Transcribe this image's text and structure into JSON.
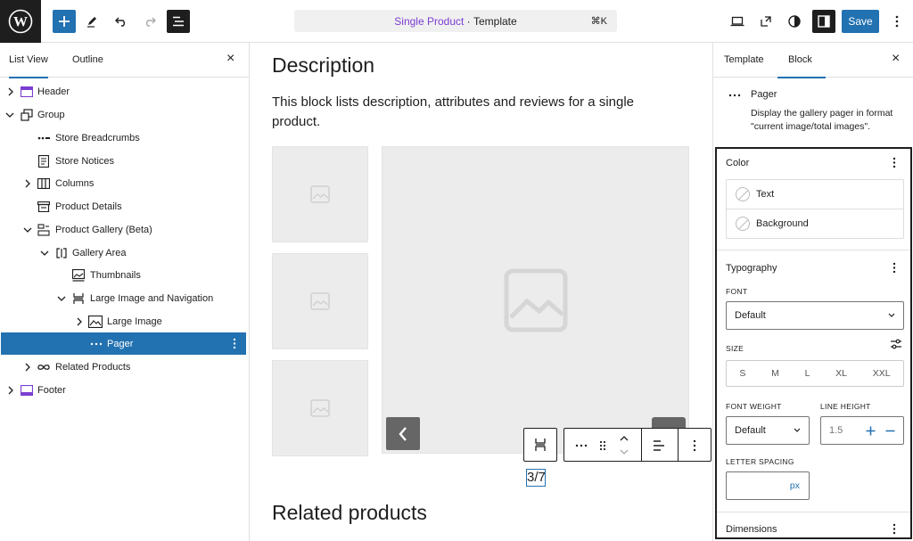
{
  "topbar": {
    "title_highlight": "Single Product",
    "title_sep": " · ",
    "title_rest": "Template",
    "shortcut": "⌘K",
    "save_label": "Save"
  },
  "left_panel": {
    "tabs": [
      "List View",
      "Outline"
    ],
    "close": "×",
    "items": [
      {
        "label": "Header"
      },
      {
        "label": "Group"
      },
      {
        "label": "Store Breadcrumbs"
      },
      {
        "label": "Store Notices"
      },
      {
        "label": "Columns"
      },
      {
        "label": "Product Details"
      },
      {
        "label": "Product Gallery (Beta)"
      },
      {
        "label": "Gallery Area"
      },
      {
        "label": "Thumbnails"
      },
      {
        "label": "Large Image and Navigation"
      },
      {
        "label": "Large Image"
      },
      {
        "label": "Pager"
      },
      {
        "label": "Related Products"
      },
      {
        "label": "Footer"
      }
    ]
  },
  "canvas": {
    "heading": "Description",
    "text": "This block lists description, attributes and reviews for a single product.",
    "pager": "3/7",
    "related_heading": "Related products"
  },
  "sidebar": {
    "tabs": [
      "Template",
      "Block"
    ],
    "close": "×",
    "block_name": "Pager",
    "block_desc": "Display the gallery pager in format \"current image/total images\".",
    "color": {
      "title": "Color",
      "text": "Text",
      "background": "Background"
    },
    "typography": {
      "title": "Typography",
      "font_label": "FONT",
      "font_value": "Default",
      "size_label": "SIZE",
      "sizes": [
        "S",
        "M",
        "L",
        "XL",
        "XXL"
      ],
      "weight_label": "FONT WEIGHT",
      "weight_value": "Default",
      "lh_label": "LINE HEIGHT",
      "lh_value": "1.5",
      "ls_label": "LETTER SPACING",
      "ls_unit": "px"
    },
    "dimensions_title": "Dimensions"
  },
  "colors": {
    "accent": "#2271b1",
    "purple": "#7c3ed0",
    "dark": "#1e1e1e"
  }
}
